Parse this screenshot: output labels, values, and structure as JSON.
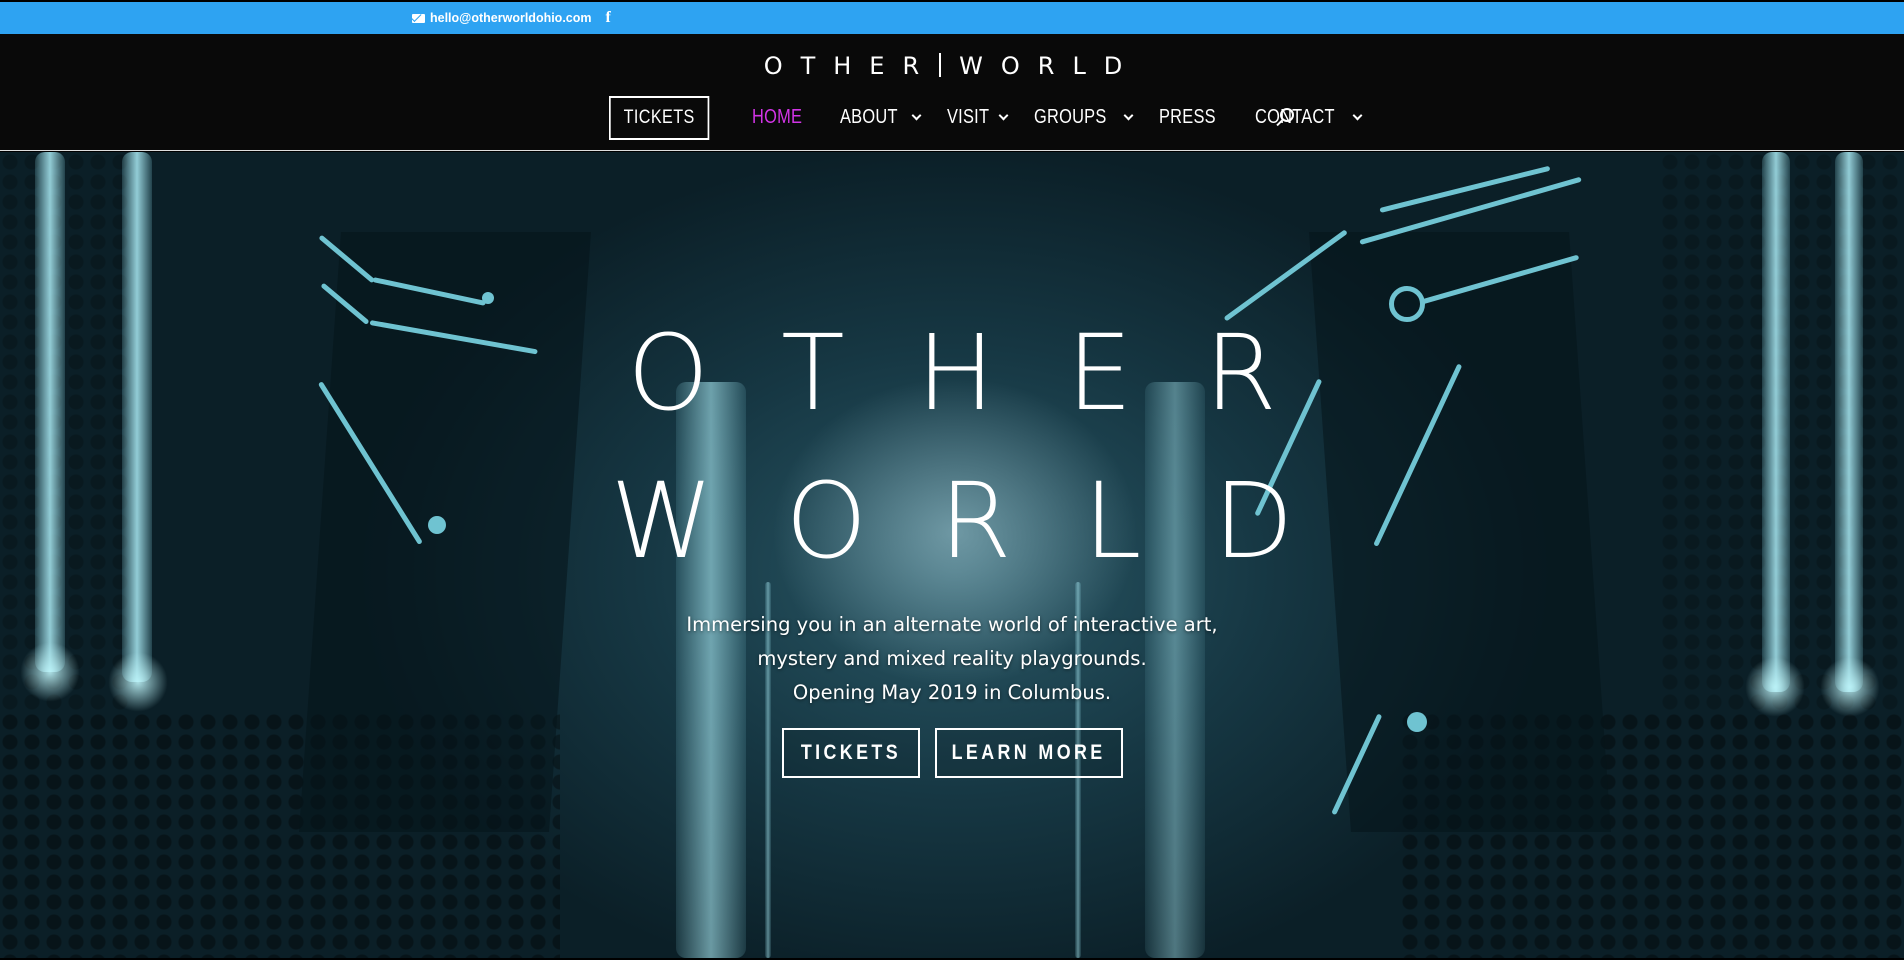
{
  "topbar": {
    "email": "hello@otherworldohio.com",
    "social_icon": "facebook-icon",
    "background_color": "#2ea3f2"
  },
  "header": {
    "logo_left": "OTHER",
    "logo_right": "WORLD",
    "nav": {
      "tickets_label": "TICKETS",
      "items": [
        {
          "label": "HOME",
          "active": true,
          "dropdown": false
        },
        {
          "label": "ABOUT",
          "active": false,
          "dropdown": true
        },
        {
          "label": "VISIT",
          "active": false,
          "dropdown": true
        },
        {
          "label": "GROUPS",
          "active": false,
          "dropdown": true
        },
        {
          "label": "PRESS",
          "active": false,
          "dropdown": false
        },
        {
          "label": "CONTACT",
          "active": false,
          "dropdown": true
        }
      ],
      "active_color": "#d234e6",
      "search_icon": "search-icon"
    }
  },
  "hero": {
    "title_line1": "OTHER",
    "title_line2": "WORLD",
    "text_line1": "Immersing you in an alternate world of interactive art,",
    "text_line2": "mystery and mixed reality playgrounds.",
    "text_line3": "Opening May 2019 in Columbus.",
    "button_tickets": "TICKETS",
    "button_learn_more": "LEARN MORE"
  }
}
